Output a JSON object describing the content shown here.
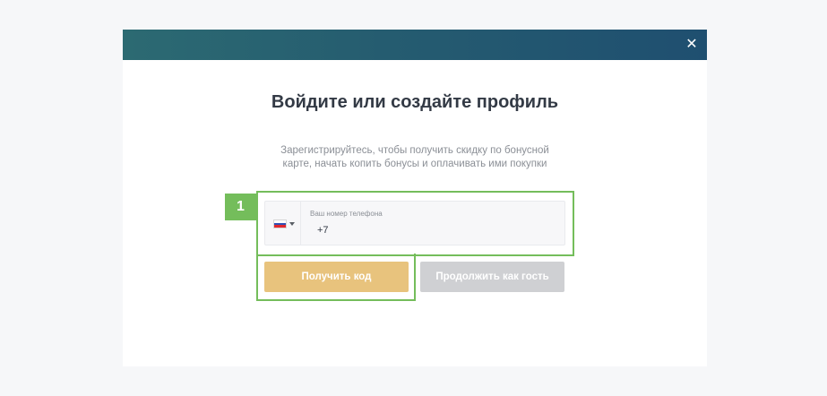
{
  "modal": {
    "close_glyph": "✕",
    "title": "Войдите или создайте профиль",
    "subtitle_line1": "Зарегистрируйтесь, чтобы получить скидку по бонусной",
    "subtitle_line2": "карте, начать копить бонусы и оплачивать ими покупки"
  },
  "phone": {
    "country_flag": "ru-flag-icon",
    "flag_colors": [
      "#ffffff",
      "#2f4fb5",
      "#e0282f"
    ],
    "label": "Ваш номер телефона",
    "value": "+7"
  },
  "buttons": {
    "get_code": "Получить код",
    "continue_guest": "Продолжить как гость"
  },
  "annotation": {
    "step_number": "1",
    "highlight_color": "#74bd5b"
  }
}
